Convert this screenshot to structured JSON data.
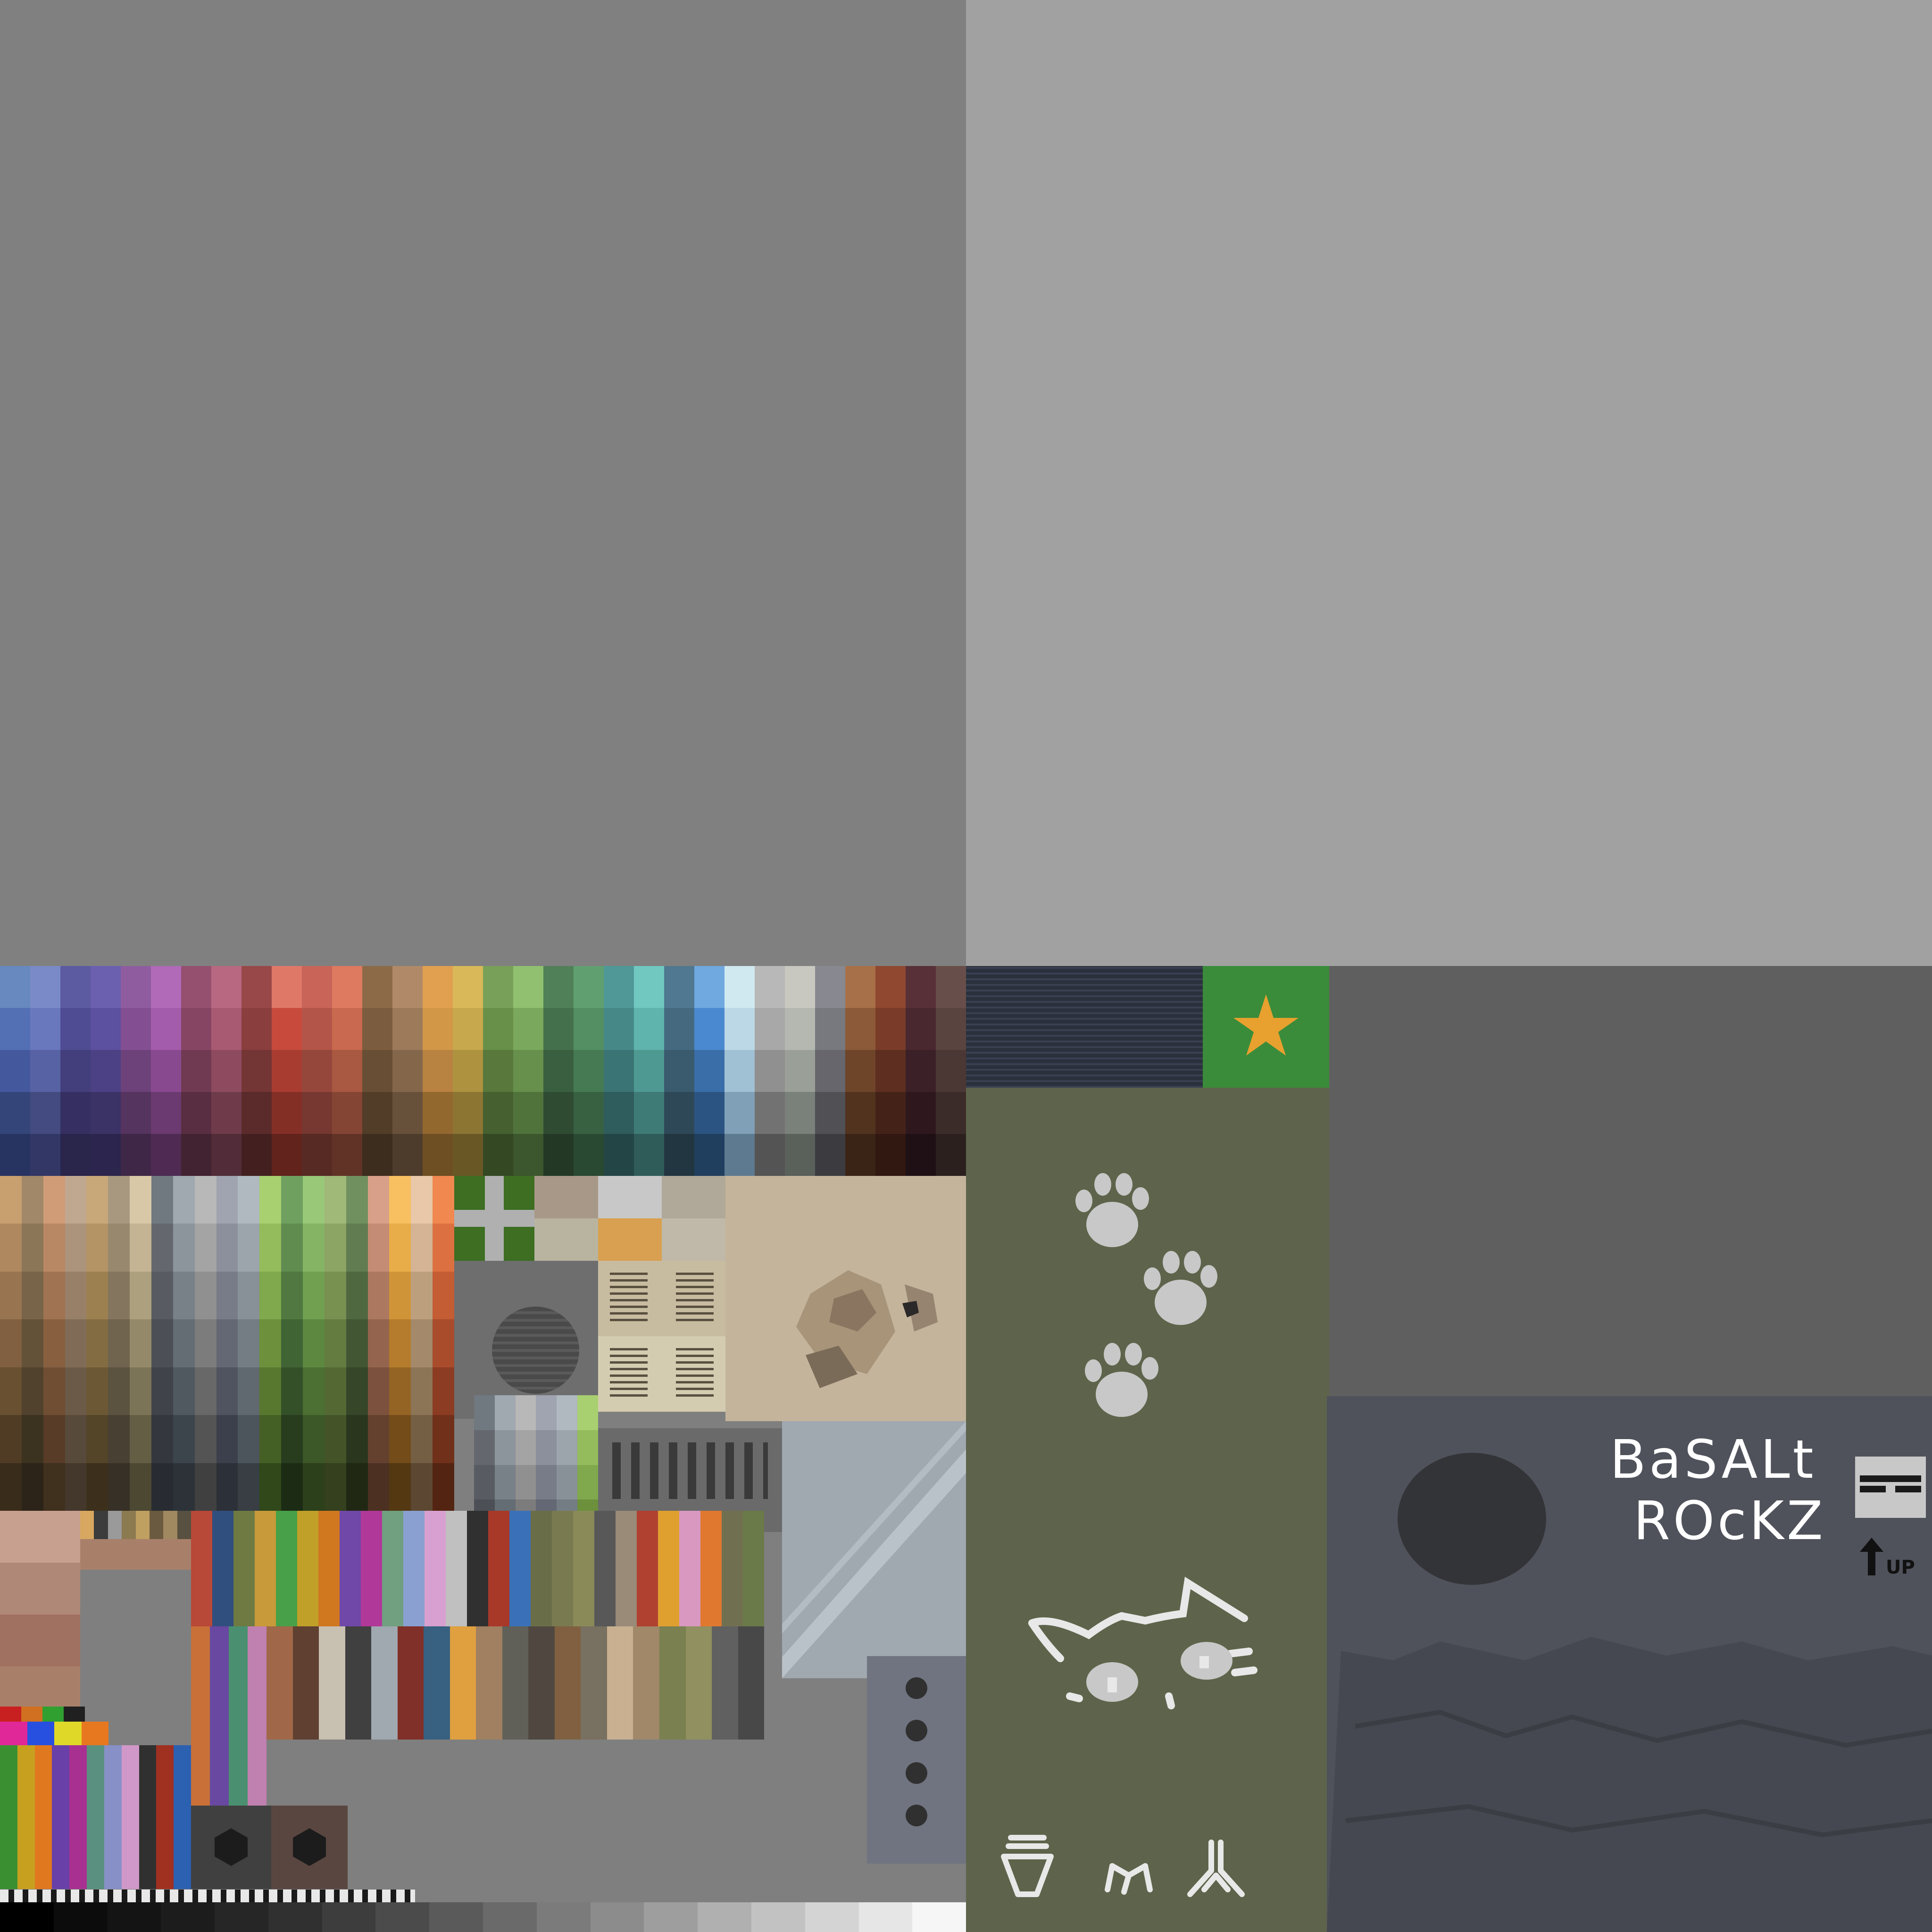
{
  "sign": {
    "line1": "BaSALt",
    "line2": "ROcKZ",
    "arrow_label": "UP"
  },
  "icons": {
    "star": "star-icon",
    "paws": "paw-print-icon",
    "cat": "sleeping-cat-icon",
    "glyph_a": "funnel-glyph-icon",
    "glyph_b": "tripod-glyph-icon",
    "glyph_c": "prong-glyph-icon",
    "kebab": "vertical-dots-icon",
    "hex": "hexagon-icon",
    "doc": "document-icon",
    "vent": "speaker-grille-icon"
  },
  "colors": {
    "gray_mid": "#808080",
    "gray_light": "#a1a1a1",
    "gray_dark": "#5f5f5f",
    "olive": "#5d644b",
    "slate": "#4f525b",
    "green": "#3a8c3a",
    "orange": "#e8a02e",
    "paw_fill": "#c8c8c8"
  },
  "palette": {
    "top_columns": [
      [
        "#6789c0",
        "#5470b5",
        "#44589e",
        "#344579",
        "#273461"
      ],
      [
        "#7a8ac8",
        "#6978bd",
        "#5762a4",
        "#434b80",
        "#323766"
      ],
      [
        "#5c5aa0",
        "#4f4c93",
        "#433f7c",
        "#353061",
        "#29254b"
      ],
      [
        "#6b5fb0",
        "#5c50a0",
        "#4c4185",
        "#3b3266",
        "#2c254d"
      ],
      [
        "#905ca0",
        "#834f92",
        "#6d427a",
        "#55345f",
        "#3f2747"
      ],
      [
        "#b06ab8",
        "#a35cab",
        "#89498f",
        "#6b3a70",
        "#4f2b53"
      ],
      [
        "#955070",
        "#874564",
        "#713a53",
        "#592e42",
        "#422331"
      ],
      [
        "#b86880",
        "#a85a72",
        "#8e4b60",
        "#6f3b4b",
        "#522c38"
      ],
      [
        "#984848",
        "#8a3e3e",
        "#743535",
        "#5b2a2a",
        "#431f1f"
      ],
      [
        "#e07868",
        "#c84a3c",
        "#a83c30",
        "#842f26",
        "#61231c"
      ],
      [
        "#c86458",
        "#b35548",
        "#96473c",
        "#763830",
        "#572a24"
      ],
      [
        "#de7a60",
        "#c9694f",
        "#a95841",
        "#854534",
        "#613327"
      ],
      [
        "#8c6a48",
        "#7c5c3e",
        "#684e34",
        "#523d29",
        "#3d2d1f"
      ],
      [
        "#b08a68",
        "#9d7a5a",
        "#84674b",
        "#68513b",
        "#4d3c2c"
      ],
      [
        "#e0a050",
        "#d29848",
        "#b88240",
        "#93682f",
        "#6e4e23"
      ],
      [
        "#d8b858",
        "#c8a84c",
        "#ae923f",
        "#8c7533",
        "#695826"
      ],
      [
        "#78a058",
        "#689048",
        "#58783c",
        "#466030",
        "#344824"
      ],
      [
        "#90c070",
        "#7aa85c",
        "#66904c",
        "#50733c",
        "#3c562d"
      ],
      [
        "#508058",
        "#45704c",
        "#3a5f40",
        "#2f4c33",
        "#233926"
      ],
      [
        "#60a070",
        "#538f62",
        "#467a53",
        "#386142",
        "#2a4932"
      ],
      [
        "#509898",
        "#468888",
        "#3b7474",
        "#2f5c5c",
        "#234545"
      ],
      [
        "#70c8c0",
        "#5fb4ad",
        "#4f9993",
        "#3f7b76",
        "#2f5c58"
      ],
      [
        "#507890",
        "#456a80",
        "#3a5a6d",
        "#2e4857",
        "#223641"
      ],
      [
        "#70a8e0",
        "#4a88d0",
        "#3a6ea8",
        "#2c5482",
        "#203e5e"
      ],
      [
        "#d0e8f0",
        "#bcd8e6",
        "#a0c0d4",
        "#80a0b8",
        "#5e7a90"
      ],
      [
        "#b8b8b8",
        "#a8a8a8",
        "#909090",
        "#727272",
        "#545454"
      ],
      [
        "#c8c8c0",
        "#b4b8b0",
        "#9aa098",
        "#7a807a",
        "#5a605a"
      ],
      [
        "#888890",
        "#78787f",
        "#66666c",
        "#505055",
        "#3c3c40"
      ],
      [
        "#a87048",
        "#8c5a38",
        "#6e4529",
        "#52331e",
        "#3a2415"
      ],
      [
        "#904830",
        "#7a3c28",
        "#5e2e20",
        "#452218",
        "#311811"
      ],
      [
        "#583038",
        "#4a2830",
        "#3c2027",
        "#2e181e",
        "#1f1015"
      ],
      [
        "#684e4a",
        "#5a4440",
        "#4b3835",
        "#3b2c29",
        "#2c201e"
      ]
    ],
    "mid_columns": [
      [
        "#c8a070",
        "#b08860",
        "#987450",
        "#806040",
        "#685030",
        "#503c24",
        "#3a2c1a"
      ],
      [
        "#a08868",
        "#8c7658",
        "#786448",
        "#645238",
        "#50422c",
        "#3c3220",
        "#2c2418"
      ],
      [
        "#d09c78",
        "#b88864",
        "#a07452",
        "#886040",
        "#704e34",
        "#583c28",
        "#40301e"
      ],
      [
        "#c0a890",
        "#ac947c",
        "#988068",
        "#806c56",
        "#6c5a48",
        "#584a3a",
        "#44382c"
      ],
      [
        "#c8a878",
        "#b49464",
        "#9c8050",
        "#846c42",
        "#6c5834",
        "#544428",
        "#3c301c"
      ],
      [
        "#a89880",
        "#98886e",
        "#84765e",
        "#70644e",
        "#5c5240",
        "#484032",
        "#363026"
      ],
      [
        "#d8c8a8",
        "#c4b494",
        "#aca07e",
        "#948a6a",
        "#7c7456",
        "#645e44",
        "#4c4832"
      ],
      [
        "#707880",
        "#64686e",
        "#585c62",
        "#4c5056",
        "#40444a",
        "#34383e",
        "#282c32"
      ],
      [
        "#a0a8b0",
        "#8c949c",
        "#788088",
        "#646c74",
        "#505860",
        "#3c444c",
        "#2c3238"
      ],
      [
        "#b8b8b8",
        "#a4a4a4",
        "#909090",
        "#7c7c7c",
        "#686868",
        "#545454",
        "#404040"
      ],
      [
        "#a0a4b0",
        "#8c909c",
        "#787c88",
        "#646874",
        "#505460",
        "#3c404c",
        "#2c3038"
      ],
      [
        "#b0b8c0",
        "#9ca4ac",
        "#889098",
        "#747c84",
        "#606870",
        "#4c545c",
        "#383e44"
      ],
      [
        "#a8d070",
        "#94bc5c",
        "#80a84c",
        "#6c903c",
        "#587830",
        "#446024",
        "#30481a"
      ],
      [
        "#70a060",
        "#608c50",
        "#507840",
        "#406434",
        "#345028",
        "#283c1e",
        "#1c2c14"
      ],
      [
        "#98c878",
        "#84b464",
        "#70a050",
        "#5c8840",
        "#4c7034",
        "#3c5828",
        "#2c401c"
      ],
      [
        "#a0b878",
        "#8ca464",
        "#789050",
        "#647c40",
        "#546834",
        "#445428",
        "#34401e"
      ],
      [
        "#709060",
        "#607c50",
        "#506840",
        "#425634",
        "#364628",
        "#2a361e",
        "#202814"
      ],
      [
        "#d8a088",
        "#c48c74",
        "#ac7860",
        "#94644e",
        "#7c523e",
        "#64402e",
        "#4c3022"
      ],
      [
        "#f8c060",
        "#e8ac48",
        "#d09438",
        "#b47c2c",
        "#946424",
        "#744c1a",
        "#543812"
      ],
      [
        "#e8c8a8",
        "#d4b494",
        "#bca07e",
        "#a48a6a",
        "#8c7456",
        "#745e44",
        "#5c4832"
      ],
      [
        "#f08850",
        "#dc7040",
        "#c45c34",
        "#a84c2c",
        "#8c3c22",
        "#70301a",
        "#542412"
      ]
    ],
    "row_swatches": [
      "#d8a860",
      "#3c3c3c",
      "#9a9a9a",
      "#8c7a50",
      "#c0a060",
      "#6a5a40",
      "#a08860",
      "#585040"
    ],
    "bright_row": [
      "#e02898",
      "#2850e0",
      "#e0d828",
      "#e87820"
    ],
    "bright_small": [
      "#c82020",
      "#d07020",
      "#30a030",
      "#202020"
    ],
    "stripe_a": [
      "#c87038",
      "#6848a0",
      "#4a9070",
      "#c080b0"
    ],
    "stripe_b": [
      "#3a9030",
      "#c8a020",
      "#e07820",
      "#6840a8",
      "#a83090",
      "#5a9080",
      "#8890c8",
      "#d098c8",
      "#303030",
      "#a03020",
      "#2c60b0"
    ],
    "grid_top": [
      "#b84838",
      "#304f7f",
      "#6e7a42",
      "#c89a3a",
      "#48a048",
      "#c0a028",
      "#d07820",
      "#7048a8",
      "#b03898",
      "#70a080",
      "#8aa0d0",
      "#d8a0d0",
      "#c0c0c0",
      "#303030",
      "#a83828",
      "#3a70b8",
      "#6a6e48",
      "#7a7a50",
      "#8a8a58",
      "#585858",
      "#9a8a78",
      "#b04030",
      "#e0a030",
      "#d898c0",
      "#e07830",
      "#707050",
      "#6a7a48"
    ],
    "grid_bottom": [
      "#a06848",
      "#604030",
      "#c8c0b0",
      "#404040",
      "#a0a8b0",
      "#803028",
      "#386080",
      "#e0a040",
      "#a08060",
      "#606058",
      "#504840",
      "#806040",
      "#787060",
      "#c8b090",
      "#a08868",
      "#7a8050",
      "#909060",
      "#606060",
      "#484848"
    ],
    "gray_ramp": [
      "#000000",
      "#0c0c0c",
      "#141414",
      "#1c1c1c",
      "#262626",
      "#303030",
      "#3d3d3d",
      "#4b4b4b",
      "#5a5a5a",
      "#6a6a6a",
      "#7b7b7b",
      "#8c8c8c",
      "#9e9e9e",
      "#b0b0b0",
      "#c2c2c2",
      "#d4d4d4",
      "#e6e6e6",
      "#f6f6f6"
    ]
  }
}
